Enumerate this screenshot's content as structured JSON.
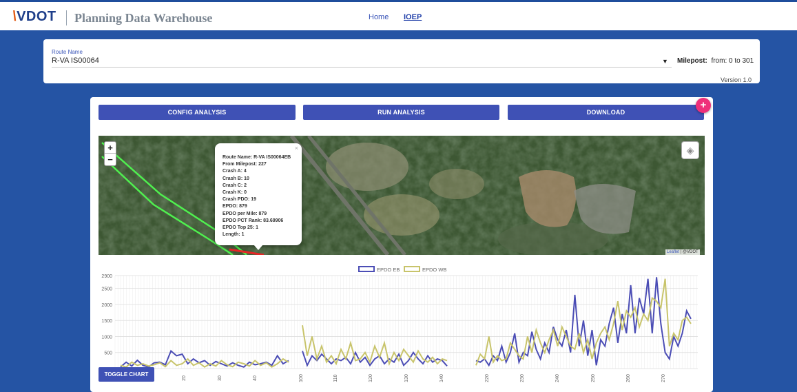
{
  "header": {
    "logo_text": "VDOT",
    "app_title": "Planning Data Warehouse",
    "nav": [
      {
        "label": "Home"
      },
      {
        "label": "IOEP"
      }
    ]
  },
  "route": {
    "label": "Route Name",
    "value": "R-VA IS00064",
    "milepost_label": "Milepost:",
    "milepost_range": "from: 0 to 301",
    "version": "Version 1.0"
  },
  "toolbar": {
    "config_label": "CONFIG ANALYSIS",
    "run_label": "RUN ANALYSIS",
    "download_label": "DOWNLOAD",
    "fab_label": "+"
  },
  "map": {
    "zoom_in": "+",
    "zoom_out": "−",
    "attribution_link": "Leaflet",
    "attribution_rest": " | @VDOT",
    "popup": {
      "close": "×",
      "lines": [
        "Route Name: R-VA IS00064EB",
        "From Milepost: 227",
        "Crash A: 4",
        "Crash B: 10",
        "Crash C: 2",
        "Crash K: 0",
        "Crash PDO: 19",
        "EPDO: 879",
        "EPDO per Mile: 879",
        "EPDO PCT Rank: 83.69906",
        "EPDO Top 25: 1",
        "Length: 1"
      ]
    }
  },
  "toggle_chart_label": "TOGGLE CHART",
  "chart_data": {
    "type": "line",
    "yticks": [
      2900,
      2500,
      2000,
      1500,
      1000,
      500,
      0
    ],
    "ylim": [
      0,
      2900
    ],
    "xticks": [
      "20",
      "30",
      "40",
      "100",
      "110",
      "120",
      "130",
      "140",
      "220",
      "230",
      "240",
      "250",
      "260",
      "270"
    ],
    "series": [
      {
        "name": "EPDO EB",
        "color": "#4b4db5",
        "segments": [
          [
            [
              0,
              50
            ],
            [
              4,
              200
            ],
            [
              8,
              80
            ],
            [
              12,
              260
            ],
            [
              16,
              100
            ],
            [
              20,
              50
            ],
            [
              24,
              180
            ],
            [
              28,
              200
            ],
            [
              32,
              120
            ],
            [
              36,
              550
            ],
            [
              40,
              400
            ],
            [
              44,
              450
            ],
            [
              48,
              150
            ],
            [
              52,
              300
            ],
            [
              56,
              180
            ],
            [
              60,
              250
            ],
            [
              64,
              100
            ],
            [
              68,
              220
            ],
            [
              72,
              150
            ],
            [
              76,
              80
            ],
            [
              80,
              180
            ],
            [
              84,
              100
            ],
            [
              88,
              50
            ],
            [
              92,
              200
            ],
            [
              96,
              120
            ],
            [
              100,
              150
            ],
            [
              104,
              200
            ],
            [
              108,
              100
            ],
            [
              112,
              400
            ],
            [
              116,
              150
            ],
            [
              120,
              250
            ]
          ],
          [
            [
              0,
              550
            ],
            [
              4,
              100
            ],
            [
              8,
              400
            ],
            [
              12,
              250
            ],
            [
              16,
              450
            ],
            [
              20,
              300
            ],
            [
              24,
              150
            ],
            [
              28,
              300
            ],
            [
              32,
              250
            ],
            [
              36,
              350
            ],
            [
              40,
              150
            ],
            [
              44,
              500
            ],
            [
              48,
              200
            ],
            [
              52,
              350
            ],
            [
              56,
              100
            ],
            [
              60,
              300
            ],
            [
              64,
              400
            ],
            [
              68,
              150
            ],
            [
              72,
              300
            ],
            [
              76,
              200
            ],
            [
              80,
              450
            ],
            [
              84,
              100
            ],
            [
              88,
              250
            ],
            [
              92,
              500
            ],
            [
              96,
              300
            ],
            [
              100,
              150
            ],
            [
              104,
              400
            ],
            [
              108,
              200
            ],
            [
              112,
              300
            ],
            [
              116,
              250
            ],
            [
              120,
              80
            ]
          ],
          [
            [
              0,
              250
            ],
            [
              4,
              200
            ],
            [
              8,
              300
            ],
            [
              12,
              100
            ],
            [
              16,
              400
            ],
            [
              20,
              250
            ],
            [
              24,
              700
            ],
            [
              28,
              200
            ],
            [
              32,
              500
            ],
            [
              36,
              1100
            ],
            [
              40,
              200
            ],
            [
              44,
              500
            ],
            [
              48,
              400
            ],
            [
              52,
              1150
            ],
            [
              56,
              600
            ],
            [
              60,
              300
            ],
            [
              64,
              800
            ],
            [
              68,
              500
            ],
            [
              72,
              1300
            ],
            [
              76,
              900
            ],
            [
              80,
              700
            ],
            [
              84,
              1200
            ],
            [
              88,
              500
            ],
            [
              92,
              2300
            ],
            [
              96,
              700
            ],
            [
              100,
              1500
            ],
            [
              104,
              400
            ],
            [
              108,
              1200
            ],
            [
              112,
              100
            ],
            [
              116,
              900
            ],
            [
              120,
              700
            ],
            [
              124,
              1400
            ],
            [
              128,
              1900
            ],
            [
              132,
              800
            ],
            [
              136,
              1700
            ],
            [
              140,
              1100
            ],
            [
              144,
              2600
            ],
            [
              148,
              1100
            ],
            [
              152,
              2200
            ],
            [
              156,
              1700
            ],
            [
              160,
              2800
            ],
            [
              164,
              1100
            ],
            [
              168,
              2850
            ],
            [
              172,
              1400
            ],
            [
              176,
              500
            ],
            [
              180,
              300
            ],
            [
              184,
              1000
            ],
            [
              188,
              700
            ],
            [
              192,
              1100
            ],
            [
              196,
              1800
            ],
            [
              200,
              1550
            ]
          ]
        ]
      },
      {
        "name": "EPDO WB",
        "color": "#c8c46b",
        "segments": [
          [
            [
              0,
              100
            ],
            [
              4,
              50
            ],
            [
              8,
              200
            ],
            [
              12,
              100
            ],
            [
              16,
              150
            ],
            [
              20,
              80
            ],
            [
              24,
              120
            ],
            [
              28,
              180
            ],
            [
              32,
              60
            ],
            [
              36,
              250
            ],
            [
              40,
              100
            ],
            [
              44,
              150
            ],
            [
              48,
              300
            ],
            [
              52,
              100
            ],
            [
              56,
              180
            ],
            [
              60,
              50
            ],
            [
              64,
              150
            ],
            [
              68,
              80
            ],
            [
              72,
              250
            ],
            [
              76,
              120
            ],
            [
              80,
              60
            ],
            [
              84,
              200
            ],
            [
              88,
              150
            ],
            [
              92,
              80
            ],
            [
              96,
              250
            ],
            [
              100,
              100
            ],
            [
              104,
              180
            ],
            [
              108,
              50
            ],
            [
              112,
              150
            ],
            [
              116,
              300
            ],
            [
              120,
              200
            ]
          ],
          [
            [
              0,
              1350
            ],
            [
              4,
              400
            ],
            [
              8,
              1000
            ],
            [
              12,
              300
            ],
            [
              16,
              700
            ],
            [
              20,
              200
            ],
            [
              24,
              400
            ],
            [
              28,
              150
            ],
            [
              32,
              600
            ],
            [
              36,
              300
            ],
            [
              40,
              800
            ],
            [
              44,
              250
            ],
            [
              48,
              300
            ],
            [
              52,
              500
            ],
            [
              56,
              200
            ],
            [
              60,
              700
            ],
            [
              64,
              350
            ],
            [
              68,
              800
            ],
            [
              72,
              150
            ],
            [
              76,
              500
            ],
            [
              80,
              250
            ],
            [
              84,
              600
            ],
            [
              88,
              400
            ],
            [
              92,
              200
            ],
            [
              96,
              550
            ],
            [
              100,
              300
            ],
            [
              104,
              200
            ],
            [
              108,
              350
            ],
            [
              112,
              150
            ],
            [
              116,
              300
            ],
            [
              120,
              250
            ]
          ],
          [
            [
              0,
              100
            ],
            [
              4,
              450
            ],
            [
              8,
              300
            ],
            [
              12,
              1000
            ],
            [
              16,
              200
            ],
            [
              20,
              400
            ],
            [
              24,
              250
            ],
            [
              28,
              300
            ],
            [
              32,
              800
            ],
            [
              36,
              600
            ],
            [
              40,
              400
            ],
            [
              44,
              300
            ],
            [
              48,
              1000
            ],
            [
              52,
              500
            ],
            [
              56,
              1200
            ],
            [
              60,
              800
            ],
            [
              64,
              500
            ],
            [
              68,
              900
            ],
            [
              72,
              1200
            ],
            [
              76,
              700
            ],
            [
              80,
              1300
            ],
            [
              84,
              1000
            ],
            [
              88,
              700
            ],
            [
              92,
              600
            ],
            [
              96,
              1100
            ],
            [
              100,
              500
            ],
            [
              104,
              900
            ],
            [
              108,
              300
            ],
            [
              112,
              800
            ],
            [
              116,
              1100
            ],
            [
              120,
              1300
            ],
            [
              124,
              900
            ],
            [
              128,
              1400
            ],
            [
              132,
              2100
            ],
            [
              136,
              1200
            ],
            [
              140,
              1800
            ],
            [
              144,
              1600
            ],
            [
              148,
              1900
            ],
            [
              152,
              1300
            ],
            [
              156,
              1700
            ],
            [
              160,
              1500
            ],
            [
              164,
              2200
            ],
            [
              168,
              2100
            ],
            [
              172,
              1900
            ],
            [
              176,
              2800
            ],
            [
              180,
              700
            ],
            [
              184,
              1100
            ],
            [
              188,
              900
            ],
            [
              192,
              1500
            ],
            [
              196,
              1600
            ],
            [
              200,
              1400
            ]
          ]
        ]
      }
    ]
  }
}
